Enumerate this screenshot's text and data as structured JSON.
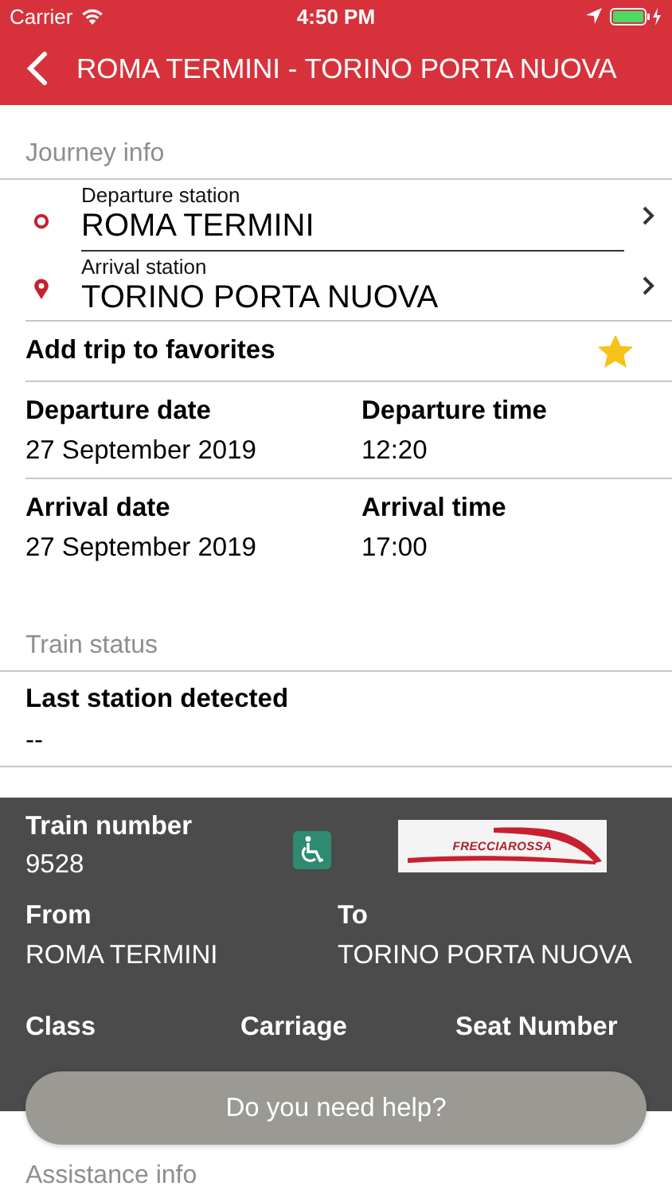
{
  "status_bar": {
    "carrier": "Carrier",
    "time": "4:50 PM",
    "charging": true
  },
  "nav_bar": {
    "title": "ROMA TERMINI - TORINO PORTA NUOVA"
  },
  "journey": {
    "header": "Journey info",
    "departure": {
      "label": "Departure station",
      "value": "ROMA TERMINI"
    },
    "arrival": {
      "label": "Arrival station",
      "value": "TORINO PORTA NUOVA"
    },
    "favorite": {
      "label": "Add trip to favorites",
      "on": true
    },
    "dates": [
      {
        "label": "Departure date",
        "value": "27 September 2019"
      },
      {
        "label": "Departure time",
        "value": "12:20"
      },
      {
        "label": "Arrival date",
        "value": "27 September 2019"
      },
      {
        "label": "Arrival time",
        "value": "17:00"
      }
    ]
  },
  "train_status": {
    "header": "Train status",
    "label": "Last station detected",
    "value": "--"
  },
  "train_card": {
    "train_number": {
      "label": "Train number",
      "value": "9528"
    },
    "accessible": true,
    "logo": "FRECCIAROSSA",
    "route": [
      {
        "label": "From",
        "value": "ROMA TERMINI"
      },
      {
        "label": "To",
        "value": "TORINO PORTA NUOVA"
      }
    ],
    "seat_columns": [
      "Class",
      "Carriage",
      "Seat Number"
    ]
  },
  "help_button": "Do you need help?",
  "assistance": {
    "header": "Assistance info"
  }
}
